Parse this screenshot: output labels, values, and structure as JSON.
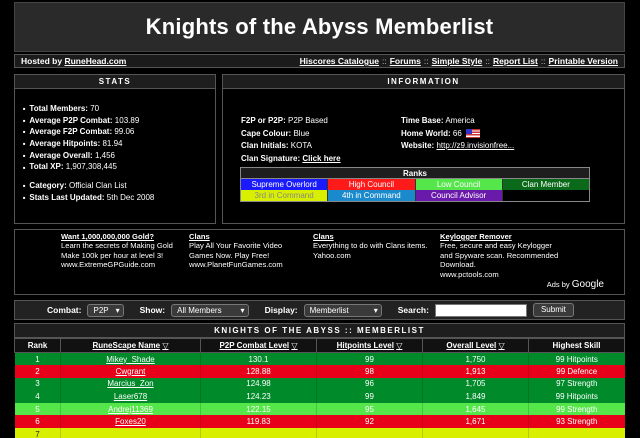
{
  "title": "Knights of the Abyss Memberlist",
  "nav": {
    "hosted_prefix": "Hosted by",
    "hosted_link": "RuneHead.com",
    "links": [
      "Hiscores Catalogue",
      "Forums",
      "Simple Style",
      "Report List",
      "Printable Version"
    ]
  },
  "stats": {
    "title": "STATS",
    "items": [
      {
        "label": "Total Members:",
        "value": "70"
      },
      {
        "label": "Average P2P Combat:",
        "value": "103.89"
      },
      {
        "label": "Average F2P Combat:",
        "value": "99.06"
      },
      {
        "label": "Average Hitpoints:",
        "value": "81.94"
      },
      {
        "label": "Average Overall:",
        "value": "1,456"
      },
      {
        "label": "Total XP:",
        "value": "1,907,308,445"
      }
    ],
    "extra": [
      {
        "label": "Category:",
        "value": "Official Clan List"
      },
      {
        "label": "Stats Last Updated:",
        "value": "5th Dec 2008"
      }
    ]
  },
  "info": {
    "title": "INFORMATION",
    "f2p_label": "F2P or P2P:",
    "f2p_value": "P2P Based",
    "timebase_label": "Time Base:",
    "timebase_value": "America",
    "cape_label": "Cape Colour:",
    "cape_value": "Blue",
    "world_label": "Home World:",
    "world_value": "66",
    "initials_label": "Clan Initials:",
    "initials_value": "KOTA",
    "website_label": "Website:",
    "website_value": "http://z9.invisionfree...",
    "signature_label": "Clan Signature:",
    "signature_value": "Click here",
    "ranks_title": "Ranks",
    "ranks": [
      [
        {
          "label": "Supreme Overlord",
          "bg": "#1a1aff",
          "fg": "#ffffff"
        },
        {
          "label": "High Council",
          "bg": "#ff1a1a",
          "fg": "#ffffff"
        },
        {
          "label": "Low Council",
          "bg": "#55e64a",
          "fg": "#ffffff"
        },
        {
          "label": "Clan Member",
          "bg": "#0a6a1a",
          "fg": "#ffffff"
        }
      ],
      [
        {
          "label": "3rd in Command",
          "bg": "#d8f000",
          "fg": "#888888"
        },
        {
          "label": "4th in Command",
          "bg": "#1a8acc",
          "fg": "#ffffff"
        },
        {
          "label": "Council Advisor",
          "bg": "#6a1aaa",
          "fg": "#ffffff"
        },
        {
          "label": "",
          "bg": "#000000",
          "fg": "#ffffff"
        }
      ]
    ]
  },
  "ads": [
    {
      "title": "Want 1,000,000,000 Gold?",
      "lines": [
        "Learn the secrets of Making Gold",
        "Make 100k per hour at level 3!",
        "www.ExtremeGPGuide.com"
      ]
    },
    {
      "title": "Clans",
      "lines": [
        "Play All Your Favorite Video",
        "Games Now. Play Free!",
        "www.PlanetFunGames.com"
      ]
    },
    {
      "title": "Clans",
      "lines": [
        "Everything to do with Clans items.",
        "Yahoo.com"
      ]
    },
    {
      "title": "Keylogger Remover",
      "lines": [
        "Free, secure and easy Keylogger",
        "and Spyware scan. Recommended",
        "Download.",
        "www.pctools.com"
      ]
    }
  ],
  "ads_by": "Ads by",
  "ads_brand": "Google",
  "filters": {
    "combat_label": "Combat:",
    "combat_value": "P2P",
    "show_label": "Show:",
    "show_value": "All Members",
    "display_label": "Display:",
    "display_value": "Memberlist",
    "search_label": "Search:",
    "submit_label": "Submit"
  },
  "memberlist": {
    "title": "KNIGHTS OF THE ABYSS :: MEMBERLIST",
    "columns": [
      "Rank",
      "RuneScape Name",
      "P2P Combat Level",
      "Hitpoints Level",
      "Overall Level",
      "Highest Skill"
    ],
    "rows": [
      {
        "rank": "1",
        "name": "Mikey_Shade",
        "combat": "130.1",
        "hp": "99",
        "overall": "1,750",
        "skill": "99 Hitpoints",
        "color": "green"
      },
      {
        "rank": "2",
        "name": "Cwgrant",
        "combat": "128.88",
        "hp": "98",
        "overall": "1,913",
        "skill": "99 Defence",
        "color": "red"
      },
      {
        "rank": "3",
        "name": "Marcius_Zon",
        "combat": "124.98",
        "hp": "96",
        "overall": "1,705",
        "skill": "97 Strength",
        "color": "green"
      },
      {
        "rank": "4",
        "name": "Laser678",
        "combat": "124.23",
        "hp": "99",
        "overall": "1,849",
        "skill": "99 Hitpoints",
        "color": "green"
      },
      {
        "rank": "5",
        "name": "Andrej11369",
        "combat": "122.15",
        "hp": "95",
        "overall": "1,645",
        "skill": "99 Strength",
        "color": "lime"
      },
      {
        "rank": "6",
        "name": "Foxes20",
        "combat": "119.83",
        "hp": "92",
        "overall": "1,671",
        "skill": "93 Strength",
        "color": "red"
      },
      {
        "rank": "7",
        "name": "",
        "combat": "",
        "hp": "",
        "overall": "",
        "skill": "",
        "color": "yellow"
      }
    ]
  }
}
